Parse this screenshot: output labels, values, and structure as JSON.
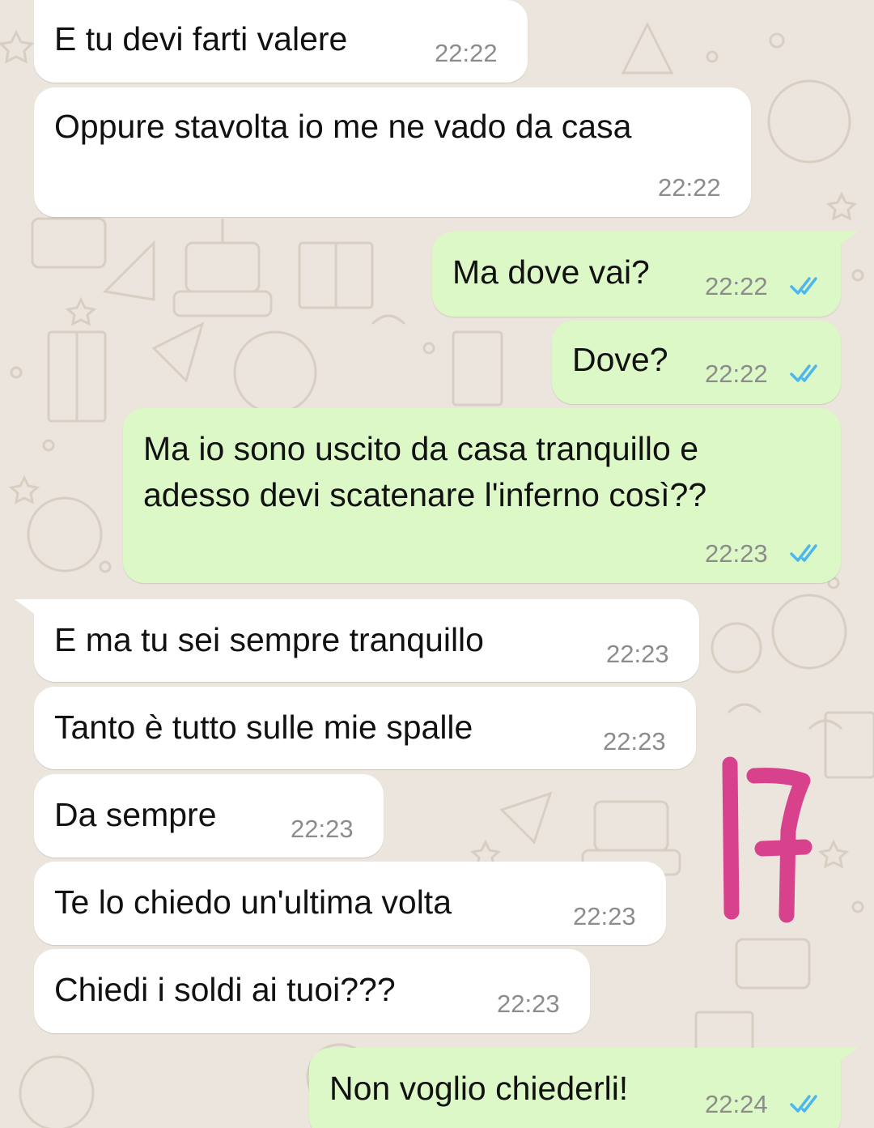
{
  "colors": {
    "background": "#ECE5DD",
    "incoming_bubble": "#FFFFFF",
    "outgoing_bubble": "#DCF8C6",
    "read_ticks": "#4FB6EC",
    "annotation": "#D8428C"
  },
  "messages": [
    {
      "direction": "in",
      "text": "E tu devi farti valere",
      "time": "22:22"
    },
    {
      "direction": "in",
      "text": "Oppure stavolta io me ne vado da casa",
      "time": "22:22"
    },
    {
      "direction": "out",
      "text": "Ma dove vai?",
      "time": "22:22",
      "status": "read"
    },
    {
      "direction": "out",
      "text": "Dove?",
      "time": "22:22",
      "status": "read"
    },
    {
      "direction": "out",
      "text_lines": [
        "Ma io sono uscito da casa tranquillo e",
        "adesso devi scatenare l'inferno così??"
      ],
      "time": "22:23",
      "status": "read"
    },
    {
      "direction": "in",
      "text": "E ma tu sei sempre tranquillo",
      "time": "22:23"
    },
    {
      "direction": "in",
      "text": "Tanto è tutto sulle mie spalle",
      "time": "22:23"
    },
    {
      "direction": "in",
      "text": "Da sempre",
      "time": "22:23"
    },
    {
      "direction": "in",
      "text": "Te lo chiedo un'ultima volta",
      "time": "22:23"
    },
    {
      "direction": "in",
      "text": "Chiedi i soldi ai tuoi???",
      "time": "22:23"
    },
    {
      "direction": "out",
      "text": "Non voglio chiederli!",
      "time": "22:24",
      "status": "read"
    }
  ],
  "annotation": {
    "handwritten_text": "17"
  }
}
